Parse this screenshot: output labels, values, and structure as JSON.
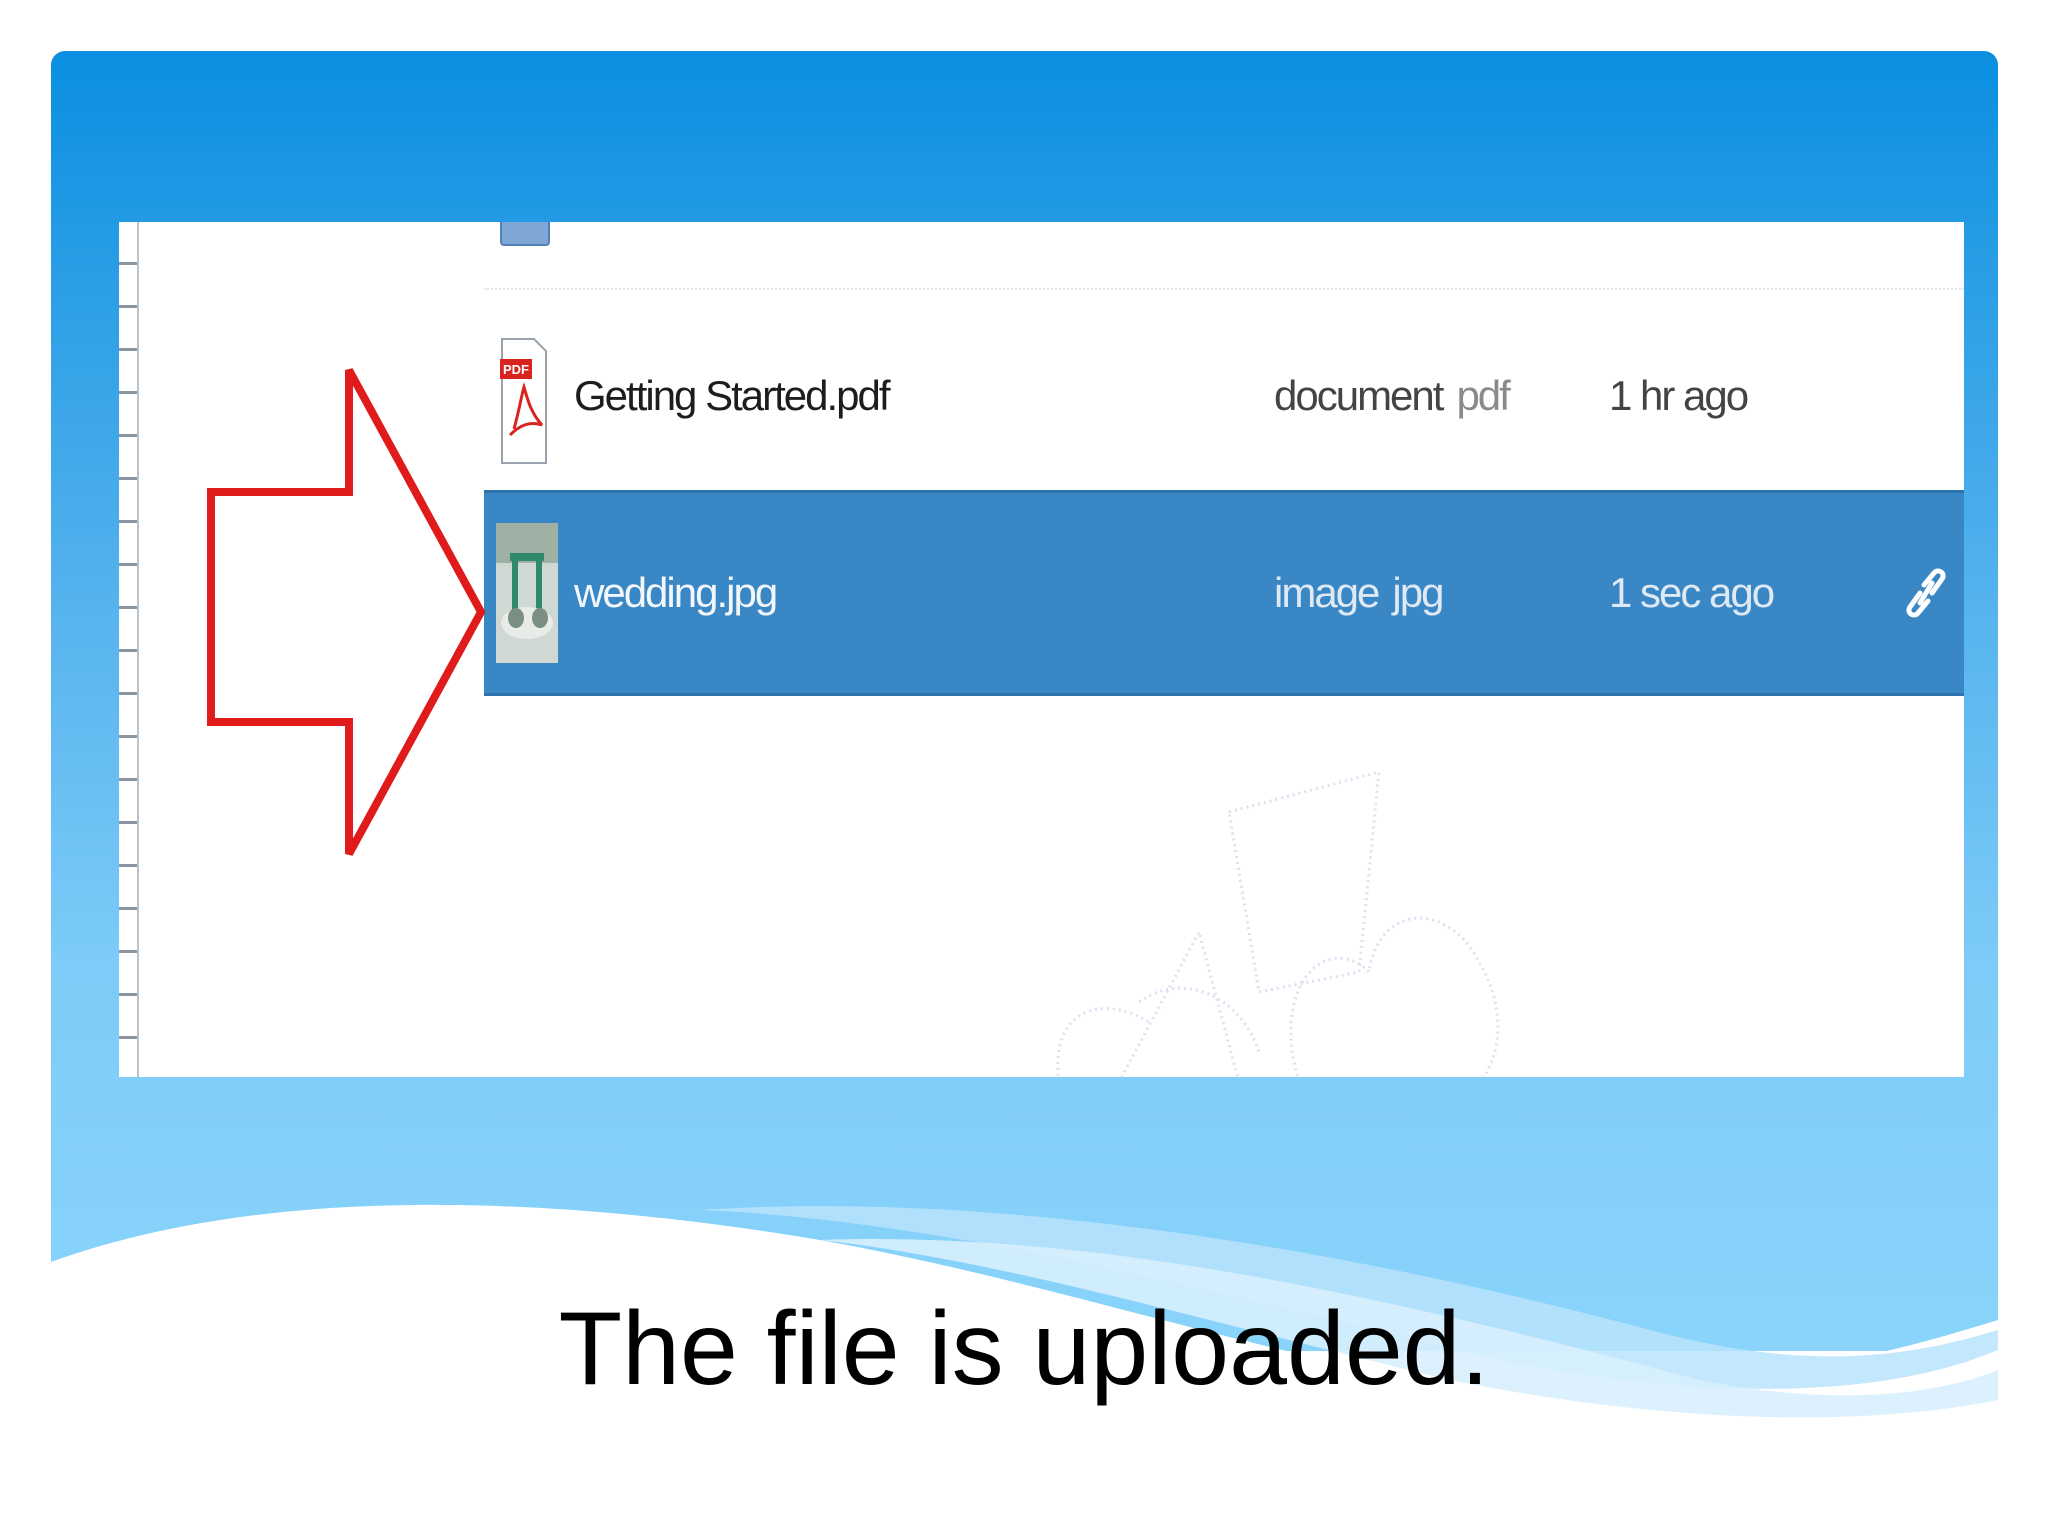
{
  "files": {
    "pdf": {
      "icon": "pdf-file-icon",
      "name": "Getting Started.pdf",
      "type": "document",
      "ext": "pdf",
      "time": "1 hr ago"
    },
    "image": {
      "icon": "image-thumbnail",
      "name": "wedding.jpg",
      "type": "image",
      "ext": "jpg",
      "time": "1 sec ago",
      "action_icon": "link-icon"
    }
  },
  "callout": {
    "icon": "red-arrow-right-icon",
    "color": "#e01b1b"
  },
  "caption": "The file is uploaded.",
  "colors": {
    "frame_top": "#0a8fe0",
    "frame_bottom": "#8ad4fb",
    "selection": "#3a87c6"
  }
}
